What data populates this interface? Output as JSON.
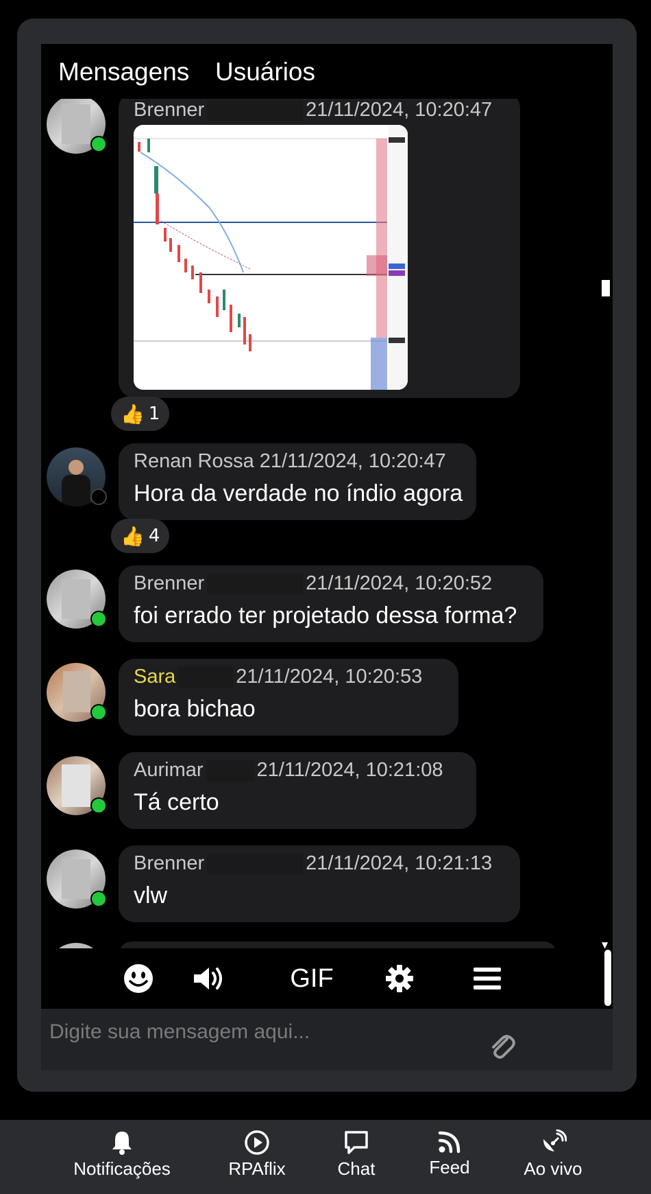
{
  "tabs": {
    "messages": "Mensagens",
    "users": "Usuários"
  },
  "messages": [
    {
      "name": "Brenner",
      "name_color": "#c9c9c9",
      "timestamp": "21/11/2024, 10:20:47",
      "text": "",
      "has_image": true,
      "online": true,
      "reaction_emoji": "👍",
      "reaction_count": "1"
    },
    {
      "name": "Renan Rossa",
      "name_color": "#c9c9c9",
      "timestamp": "21/11/2024, 10:20:47",
      "text": "Hora da verdade no índio agora",
      "has_image": false,
      "online": false,
      "reaction_emoji": "👍",
      "reaction_count": "4"
    },
    {
      "name": "Brenner",
      "name_color": "#c9c9c9",
      "timestamp": "21/11/2024, 10:20:52",
      "text": "foi errado ter projetado dessa forma?",
      "online": true
    },
    {
      "name": "Sara",
      "name_color": "#e6d84a",
      "timestamp": "21/11/2024, 10:20:53",
      "text": "bora bichao",
      "online": true
    },
    {
      "name": "Aurimar",
      "name_color": "#c9c9c9",
      "timestamp": "21/11/2024, 10:21:08",
      "text": "Tá certo",
      "online": true
    },
    {
      "name": "Brenner",
      "name_color": "#c9c9c9",
      "timestamp": "21/11/2024, 10:21:13",
      "text": "vlw",
      "online": true
    }
  ],
  "toolbar": {
    "gif_label": "GIF",
    "icons": [
      "smiley-icon",
      "speaker-icon",
      "gear-icon",
      "menu-icon"
    ]
  },
  "input": {
    "placeholder": "Digite sua mensagem aqui..."
  },
  "bottom_nav": [
    {
      "label": "Notificações",
      "icon": "bell-icon"
    },
    {
      "label": "RPAflix",
      "icon": "play-icon"
    },
    {
      "label": "Chat",
      "icon": "chat-icon"
    },
    {
      "label": "Feed",
      "icon": "rss-icon"
    },
    {
      "label": "Ao vivo",
      "icon": "broadcast-icon"
    }
  ],
  "colors": {
    "online": "#22c93a",
    "offline": "#000000",
    "bubble": "#1e1e20",
    "frame": "#2a2c30"
  }
}
